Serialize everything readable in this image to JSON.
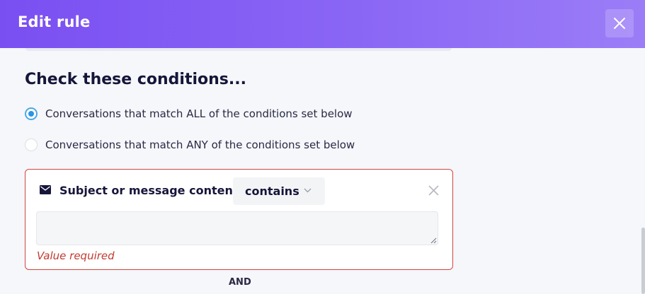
{
  "modal": {
    "title": "Edit rule",
    "close_icon": "close-icon"
  },
  "conditions": {
    "title": "Check these conditions...",
    "match_options": [
      {
        "label": "Conversations that match ALL of the conditions set below",
        "selected": true
      },
      {
        "label": "Conversations that match ANY of the conditions set below",
        "selected": false
      }
    ]
  },
  "condition_card": {
    "field_icon": "envelope-icon",
    "field_label": "Subject or message content",
    "operator": "contains",
    "value": "",
    "error": "Value required",
    "error_color": "#c23b2f"
  },
  "joiner": "AND",
  "colors": {
    "header_gradient_start": "#7a4ff2",
    "header_gradient_end": "#9b7df7",
    "radio_accent": "#2b95e0",
    "error_border": "#d2453d"
  }
}
